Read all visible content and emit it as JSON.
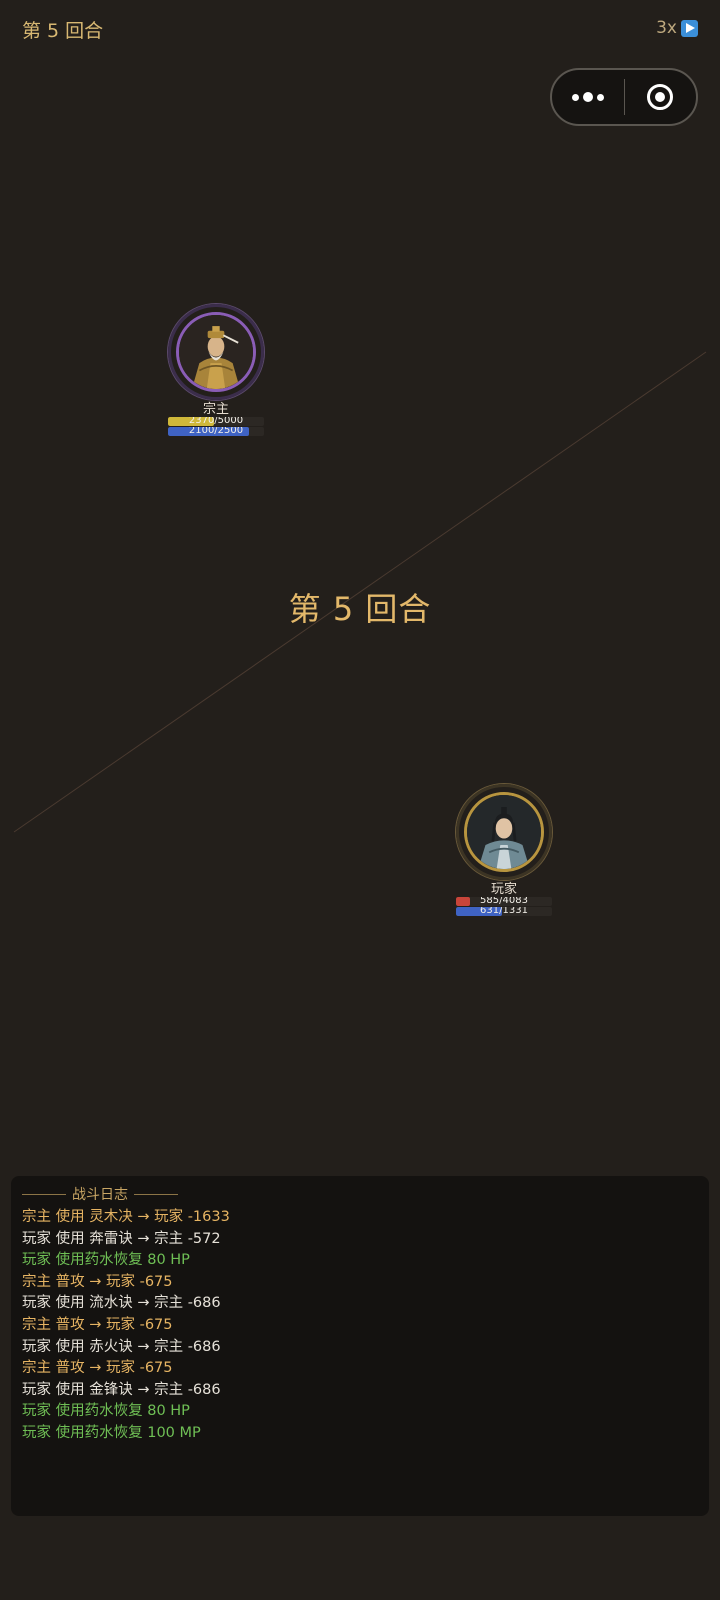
{
  "header": {
    "round_label": "第 5 回合",
    "speed_label": "3x",
    "speed_icon": "play-button-icon"
  },
  "capsule": {
    "more_icon": "more-dots-icon",
    "close_icon": "close-target-icon"
  },
  "center_banner": "第 5 回合",
  "enemy": {
    "name": "宗主",
    "hp_text": "2370/5000",
    "mp_text": "2100/2500",
    "hp_fraction": 0.474,
    "mp_fraction": 0.84,
    "ring_color": "#8a5db6",
    "hp_color": "#cfb83a"
  },
  "player": {
    "name": "玩家",
    "hp_text": "585/4083",
    "mp_text": "631/1331",
    "hp_fraction": 0.143,
    "mp_fraction": 0.474,
    "ring_color": "#b8953f",
    "hp_color": "#c8453a"
  },
  "battle_log": {
    "title": "战斗日志",
    "entries": [
      {
        "text": "宗主 使用 灵木决 → 玩家 -1633",
        "kind": "enemy"
      },
      {
        "text": "玩家 使用 奔雷诀 → 宗主 -572",
        "kind": "player"
      },
      {
        "text": "玩家 使用药水恢复 80 HP",
        "kind": "heal"
      },
      {
        "text": "宗主 普攻 → 玩家 -675",
        "kind": "enemy"
      },
      {
        "text": "玩家 使用 流水诀 → 宗主 -686",
        "kind": "player"
      },
      {
        "text": "宗主 普攻 → 玩家 -675",
        "kind": "enemy"
      },
      {
        "text": "玩家 使用 赤火诀 → 宗主 -686",
        "kind": "player"
      },
      {
        "text": "宗主 普攻 → 玩家 -675",
        "kind": "enemy"
      },
      {
        "text": "玩家 使用 金锋诀 → 宗主 -686",
        "kind": "player"
      },
      {
        "text": "玩家 使用药水恢复 80 HP",
        "kind": "heal"
      },
      {
        "text": "玩家 使用药水恢复 100 MP",
        "kind": "heal"
      }
    ]
  },
  "colors": {
    "background": "#231f1b",
    "gold_text": "#e3b86a",
    "mp_bar": "#3f63c4",
    "heal_text": "#6fbf55"
  }
}
